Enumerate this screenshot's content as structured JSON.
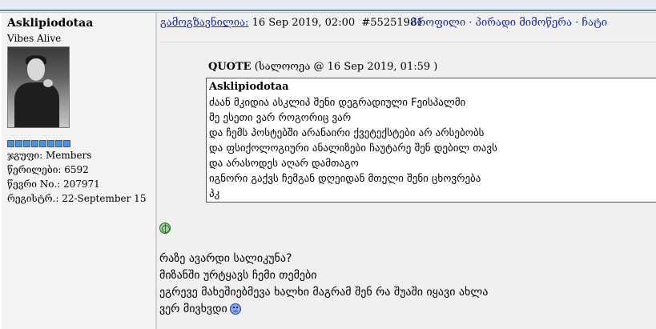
{
  "user": {
    "name": "Asklipiodotaa",
    "title": "Vibes Alive",
    "rank_pips": 8,
    "group": "ჯგუფი: Members",
    "posts": "წერილები: 6592",
    "member_no": "წევრი No.: 207971",
    "registered": "რეგისტრ.: 22-September 15"
  },
  "post": {
    "posted_label": "გამოგზავნილია:",
    "date": "16 Sep 2019, 02:00",
    "post_id": "#55251981",
    "links": {
      "profile": "· პროფილი",
      "pm": "· პირადი მიმოწერა",
      "chat": "· ჩატი"
    },
    "quote": {
      "label": "QUOTE",
      "meta": "(სალოოეა @ 16 Sep 2019, 01:59 )",
      "lines": [
        "Asklipiodotaa",
        "ძაან მკიდია ასკლიპ შენი დეგრადიული Fეისპალმი",
        "მე ესეთი ვარ როგორიც ვარ",
        "და ჩემს პოსტებში არანაირი ქვეტექსტები არ არსებობს",
        "და ფსიქოლოგიური ანალიზები ჩაუტარე შენ დებილ თავს",
        "და არასოდეს აღარ დამთაგო",
        "იგნორი გაქვს ჩემგან დღეიდან მთელი შენი ცხოვრება",
        "პკ"
      ]
    },
    "body": [
      "რაზე ავარდი სალიკუნა?",
      "მიზანში ურტყავს ჩემი თემები",
      "ეგრევე მახეშიებმევა ხალხი მაგრამ შენ რა შუაში იყავი ახლა",
      "ვერ მივხვდი"
    ],
    "icons": [
      "globe-smiley-icon",
      "sad-smiley-icon"
    ]
  },
  "colors": {
    "link": "#1a2fa0",
    "header_bar": "#6b84a6",
    "left_bg": "#f4f4f4",
    "right_bg": "#f0f0f0",
    "pip": "#4f8fd8"
  }
}
